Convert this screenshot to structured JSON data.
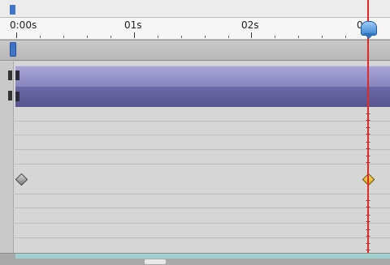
{
  "ruler": {
    "labels": [
      "0:00s",
      "01s",
      "02s",
      "0"
    ]
  },
  "timeline": {
    "current_time_indicator": "current-time-indicator",
    "keyframes": [
      "gray-keyframe",
      "yellow-keyframe"
    ]
  },
  "colors": {
    "indicator_red": "#e02a2a",
    "layer_bar_light": "#8a87c0",
    "layer_bar_dark": "#57548f",
    "keyframe_yellow": "#f2b700",
    "handle_blue": "#3f74c9"
  }
}
